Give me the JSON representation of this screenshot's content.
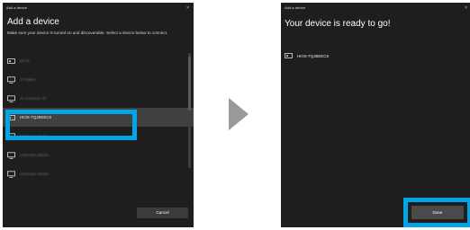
{
  "accent": "#00a6e6",
  "left_dialog": {
    "title": "Add a device",
    "close_glyph": "×",
    "heading": "Add a device",
    "instructions": "Make sure your device is turned on and discoverable. Select a device below to connect.",
    "devices": [
      {
        "name": "Mi-02",
        "icon": "storage-device-icon",
        "blurred": true
      },
      {
        "name": "SI Wales",
        "icon": "monitor-icon",
        "blurred": true
      },
      {
        "name": "SI reserved, Ri",
        "icon": "monitor-icon",
        "blurred": true
      },
      {
        "name": "HIOS-TQJBEEC8",
        "icon": "storage-device-icon",
        "blurred": false,
        "selected": true
      },
      {
        "name": "Unknown device",
        "icon": "monitor-icon",
        "blurred": true
      },
      {
        "name": "Unknown device",
        "icon": "monitor-icon",
        "blurred": true
      },
      {
        "name": "Unknown device",
        "icon": "monitor-icon",
        "blurred": true
      }
    ],
    "cancel_label": "Cancel"
  },
  "right_dialog": {
    "title": "Add a device",
    "close_glyph": "×",
    "heading": "Your device is ready to go!",
    "device_name": "HIOS-TQJBEEC8",
    "device_icon": "storage-device-icon",
    "done_label": "Done"
  }
}
